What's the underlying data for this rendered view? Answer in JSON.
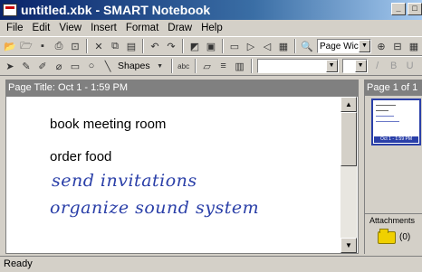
{
  "window": {
    "title": "untitled.xbk - SMART Notebook",
    "minimize_glyph": "_",
    "maximize_glyph": "□"
  },
  "menu": [
    "File",
    "Edit",
    "View",
    "Insert",
    "Format",
    "Draw",
    "Help"
  ],
  "toolbar": {
    "zoom_value": "Page Wic",
    "shapes_label": "Shapes"
  },
  "page": {
    "title": "Page Title: Oct 1 - 1:59 PM",
    "typed_lines": [
      "book meeting room",
      "order food"
    ],
    "handwritten_lines": [
      "send invitations",
      "organize sound system"
    ]
  },
  "sidebar": {
    "header": "Page 1 of 1",
    "thumb_label": "Oct 1 - 1:59 PM",
    "attachments_label": "Attachments",
    "attachments_count": "(0)"
  },
  "status": {
    "text": "Ready"
  },
  "colors": {
    "ink_blue": "#2a3fa8",
    "title_gradient_start": "#0a246a"
  }
}
